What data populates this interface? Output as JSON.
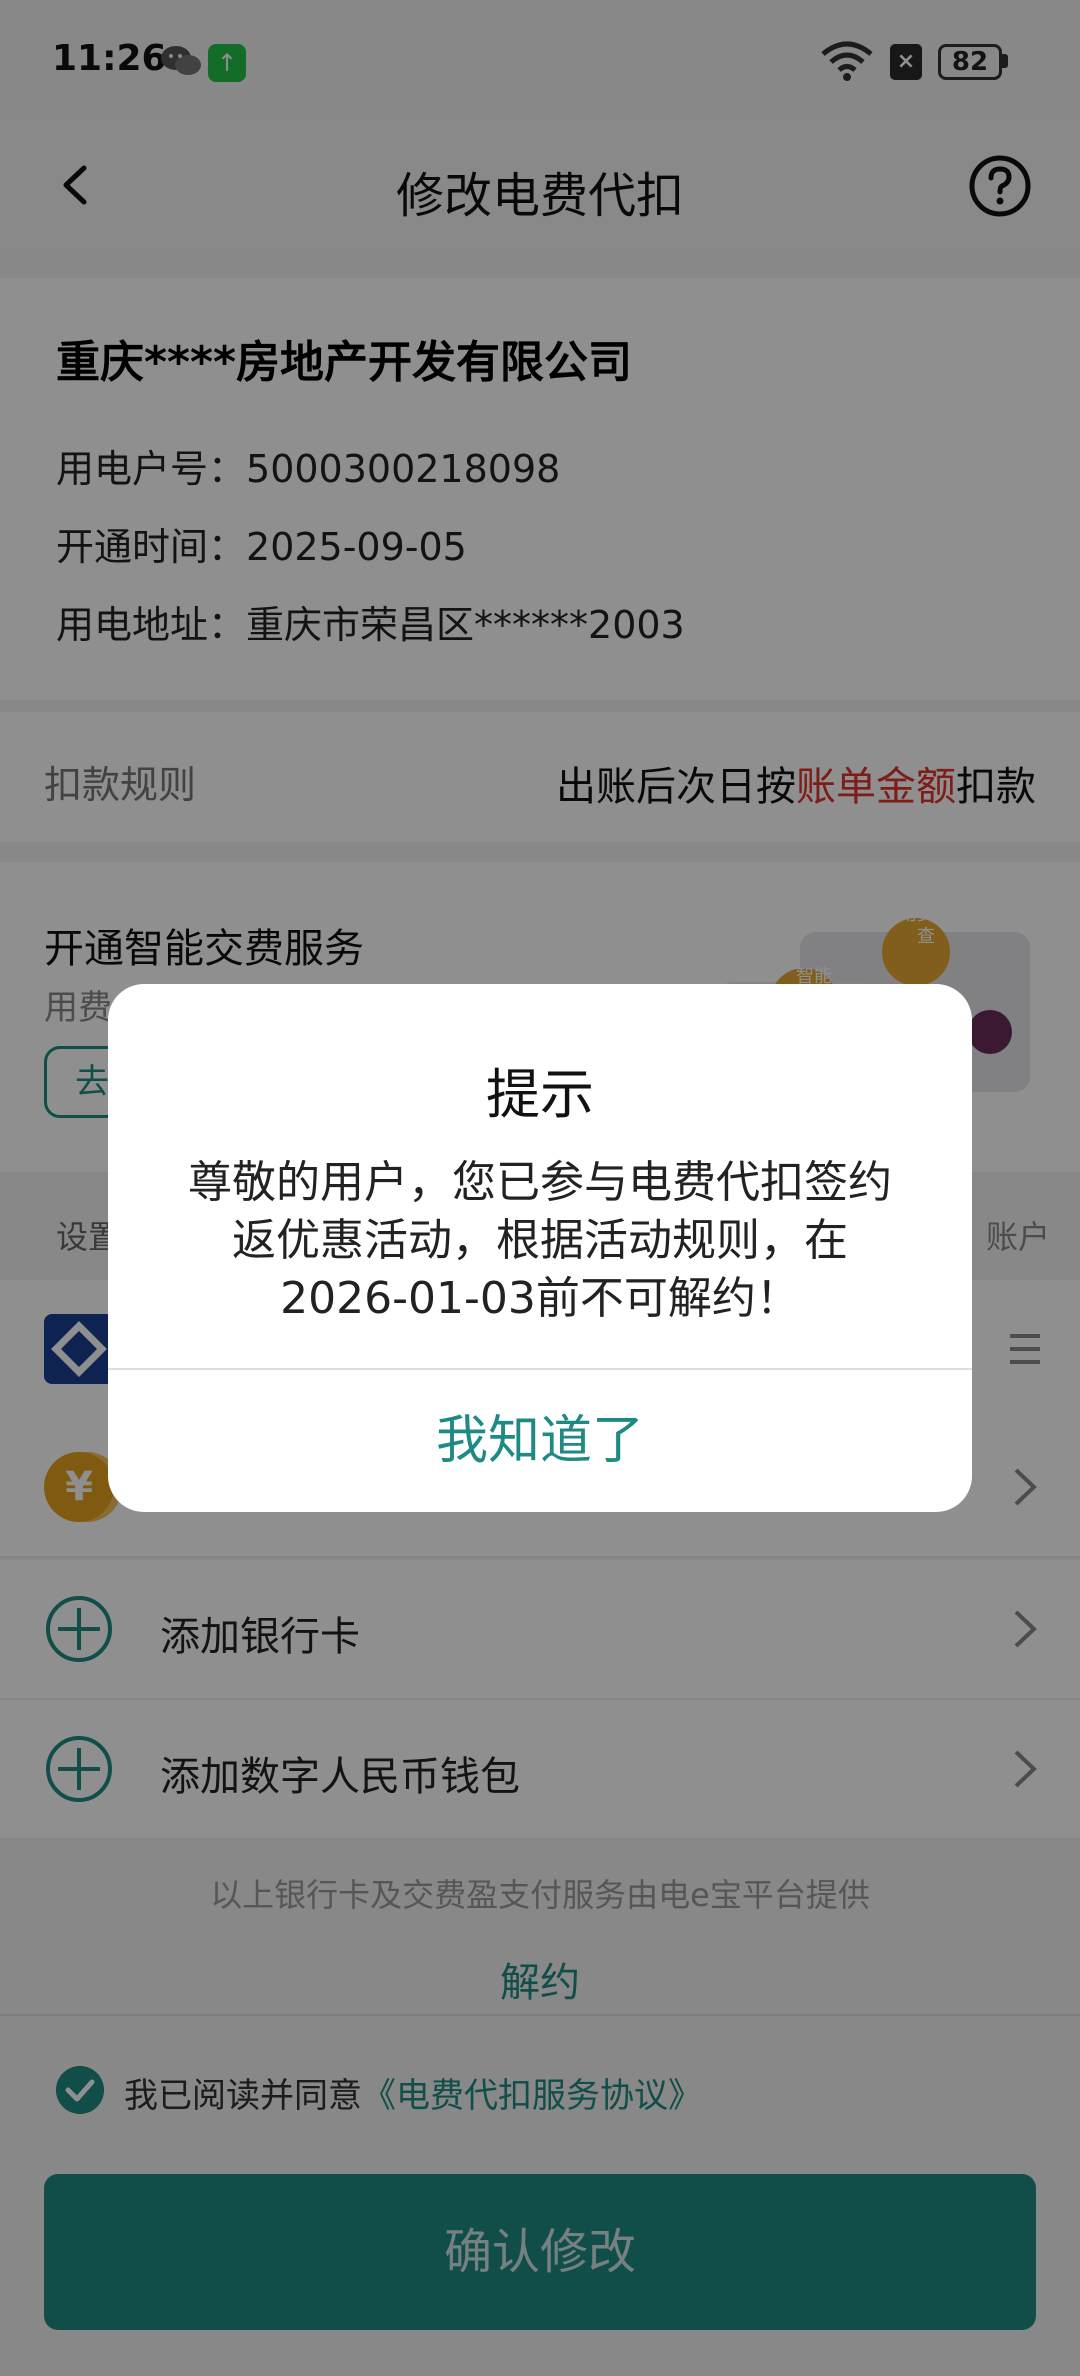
{
  "status_bar": {
    "time": "11:26",
    "sim_badge": "×",
    "battery": "82",
    "app_badge": "↑"
  },
  "header": {
    "title": "修改电费代扣"
  },
  "account": {
    "company_name": "重庆****房地产开发有限公司",
    "account_label": "用电户号：",
    "account_value": "5000300218098",
    "open_time_label": "开通时间：",
    "open_time_value": "2025-09-05",
    "address_label": "用电地址：",
    "address_value": "重庆市荣昌区******2003"
  },
  "rule": {
    "label": "扣款规则",
    "value_prefix": "出账后次日按",
    "value_highlight": "账单金额",
    "value_suffix": "扣款"
  },
  "smart_pay": {
    "title": "开通智能交费服务",
    "subtitle": "用费",
    "go_label": "去",
    "badge_top": "用费随查",
    "badge_bottom": "智能"
  },
  "method": {
    "header_label": "设置",
    "header_right": "账户",
    "add_bank_label": "添加银行卡",
    "add_wallet_label": "添加数字人民币钱包",
    "coin_symbol": "¥"
  },
  "provider_note": "以上银行卡及交费盈支付服务由电e宝平台提供",
  "cancel_label": "解约",
  "agreement": {
    "prefix": "我已阅读并同意",
    "link": "《电费代扣服务协议》"
  },
  "confirm_label": "确认修改",
  "dialog": {
    "title": "提示",
    "message": "尊敬的用户，您已参与电费代扣签约返优惠活动，根据活动规则，在2026-01-03前不可解约！",
    "ok_label": "我知道了"
  },
  "colors": {
    "accent": "#1f8a83",
    "highlight_red": "#e0322f",
    "overlay": "rgba(0,0,0,0.44)"
  }
}
